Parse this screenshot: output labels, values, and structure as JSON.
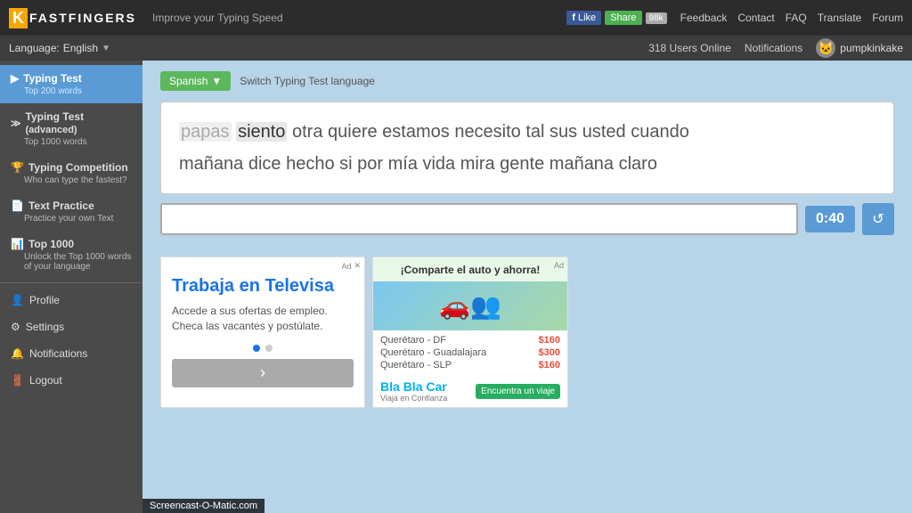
{
  "topbar": {
    "logo_k": "K",
    "logo_text": "FASTFINGERS",
    "tagline": "Improve your Typing Speed",
    "fb_like": "Like",
    "fb_share": "Share",
    "fb_count": "98k",
    "nav": {
      "feedback": "Feedback",
      "contact": "Contact",
      "faq": "FAQ",
      "translate": "Translate",
      "forum": "Forum"
    }
  },
  "secondbar": {
    "language_label": "Language:",
    "language_value": "English",
    "users_online": "318 Users Online",
    "notifications": "Notifications",
    "username": "pumpkinkake"
  },
  "sidebar": {
    "typing_test": {
      "title": "Typing Test",
      "sub": "Top 200 words",
      "active": true
    },
    "typing_test_advanced": {
      "title": "Typing Test",
      "title2": "(advanced)",
      "sub": "Top 1000 words"
    },
    "typing_competition": {
      "title": "Typing Competition",
      "sub": "Who can type the fastest?"
    },
    "text_practice": {
      "title": "Text Practice",
      "sub": "Practice your own Text"
    },
    "top1000": {
      "title": "Top 1000",
      "sub": "Unlock the Top 1000 words of your language"
    },
    "profile": "Profile",
    "settings": "Settings",
    "notifications": "Notifications",
    "logout": "Logout"
  },
  "typing_area": {
    "language_btn": "Spanish",
    "switch_text": "Switch Typing Test language",
    "text_line1": "papas siento otra quiere estamos necesito tal sus usted cuando",
    "text_line2": "mañana dice hecho si por mía vida mira gente mañana claro",
    "typed_word": "papas",
    "current_word": "siento",
    "timer": "0:40",
    "input_placeholder": ""
  },
  "ad_left": {
    "ad_marker": "Ad",
    "title": "Trabaja en Televisa",
    "body": "Accede a sus ofertas de empleo. Checa las vacantes y postúlate.",
    "next_arrow": "›"
  },
  "ad_right": {
    "ad_marker": "Ad",
    "header_text": "¡Comparte el auto y ahorra!",
    "routes": [
      {
        "name": "Querétaro - DF",
        "price": "$160"
      },
      {
        "name": "Querétaro - Guadalajara",
        "price": "$300"
      },
      {
        "name": "Querétaro - SLP",
        "price": "$160"
      }
    ],
    "blacar_logo": "Bla Bla Car",
    "tagline": "Viaja en Confianza",
    "cta": "Encuentra un viaje"
  },
  "watermark": "Screencast-O-Matic.com"
}
